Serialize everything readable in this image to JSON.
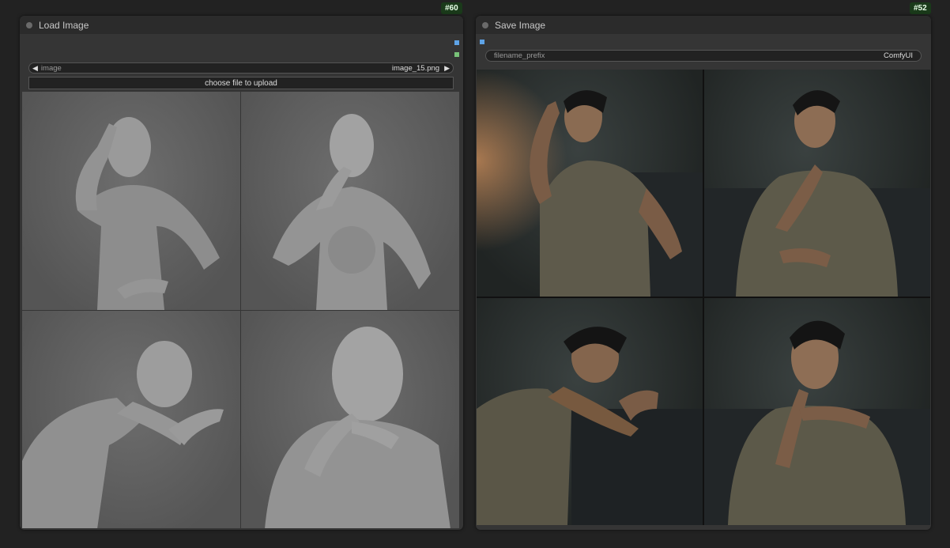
{
  "nodes": {
    "load_image": {
      "id_badge": "#60",
      "title": "Load Image",
      "image_widget": {
        "label": "image",
        "value": "image_15.png"
      },
      "upload_button": "choose file to upload"
    },
    "save_image": {
      "id_badge": "#52",
      "title": "Save Image",
      "filename_widget": {
        "label": "filename_prefix",
        "value": "ComfyUI"
      }
    }
  },
  "colors": {
    "canvas_bg": "#222222",
    "node_bg": "#353535",
    "header_bg": "#2b2b2b",
    "slot_blue": "#5ea3e6",
    "slot_green": "#78c278"
  }
}
